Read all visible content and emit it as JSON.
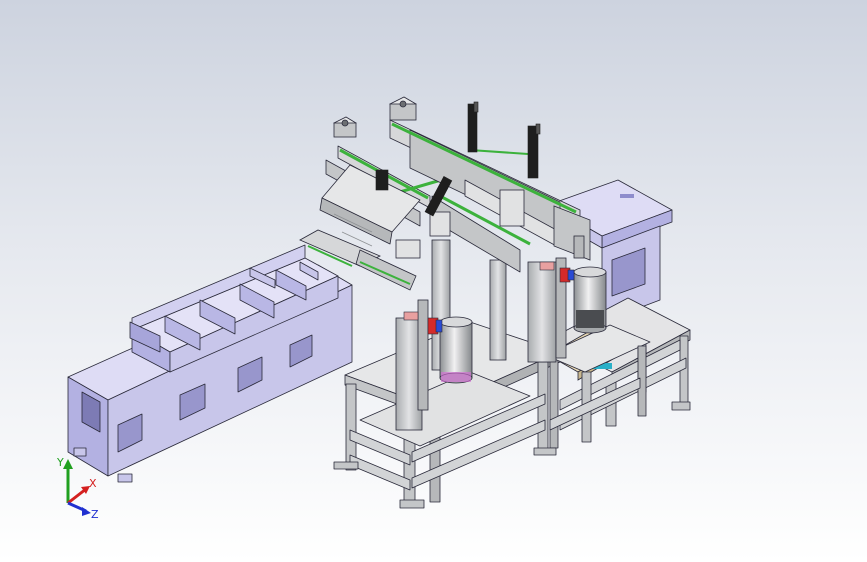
{
  "viewport": {
    "colors": {
      "background_top": "#cdd3df",
      "background_bottom": "#ffffff",
      "frame_fill": "#c8c6ea",
      "frame_dark": "#9c9ad2",
      "frame_light": "#dedcf5",
      "steel": "#c4c6c8",
      "steel_dark": "#8e9194",
      "rail_green": "#3cb23c",
      "cylinder_dark": "#1e1e1e",
      "accent_red": "#d42a2a",
      "accent_blue": "#2a4ad4",
      "fixture_tan": "#e7d8b4",
      "line": "#2a2a3a"
    }
  },
  "triad": {
    "icon": "coordinate-triad-icon",
    "x_label": "X",
    "y_label": "Y",
    "z_label": "Z",
    "x_color": "#d42020",
    "y_color": "#20a020",
    "z_color": "#2030d0"
  }
}
